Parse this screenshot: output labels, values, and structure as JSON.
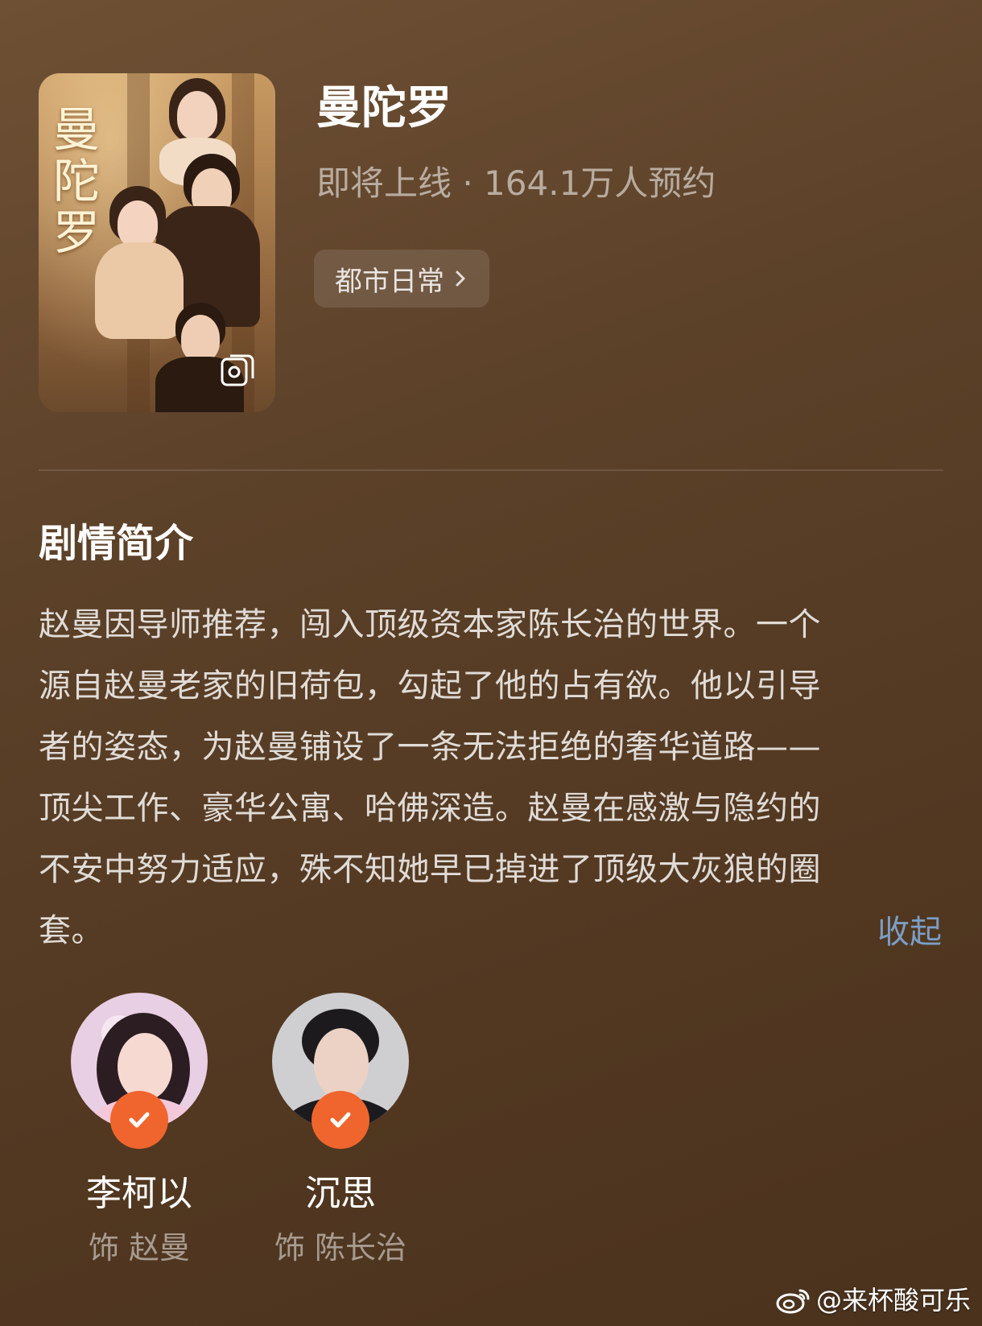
{
  "drama": {
    "title": "曼陀罗",
    "meta": "即将上线 · 164.1万人预约",
    "genre": "都市日常"
  },
  "poster": {
    "title_chars": [
      "曼",
      "陀",
      "罗"
    ]
  },
  "synopsis": {
    "heading": "剧情简介",
    "lines": [
      "赵曼因导师推荐，闯入顶级资本家陈长治的世界。一个",
      "源自赵曼老家的旧荷包，勾起了他的占有欲。他以引导",
      "者的姿态，为赵曼铺设了一条无法拒绝的奢华道路——",
      "顶尖工作、豪华公寓、哈佛深造。赵曼在感激与隐约的",
      "不安中努力适应，殊不知她早已掉进了顶级大灰狼的圈",
      "套。"
    ],
    "collapse_label": "收起"
  },
  "cast": [
    {
      "name": "李柯以",
      "role": "饰 赵曼"
    },
    {
      "name": "沉思",
      "role": "饰 陈长治"
    }
  ],
  "watermark": "@来杯酸可乐",
  "colors": {
    "background": "#5c4129",
    "accent_link": "#7c9ec6",
    "verified_badge": "#f0652d"
  },
  "icons": {
    "poster_gallery": "gallery-icon",
    "genre_arrow": "chevron-right-icon",
    "verified": "check-icon",
    "watermark_logo": "weibo-icon"
  }
}
